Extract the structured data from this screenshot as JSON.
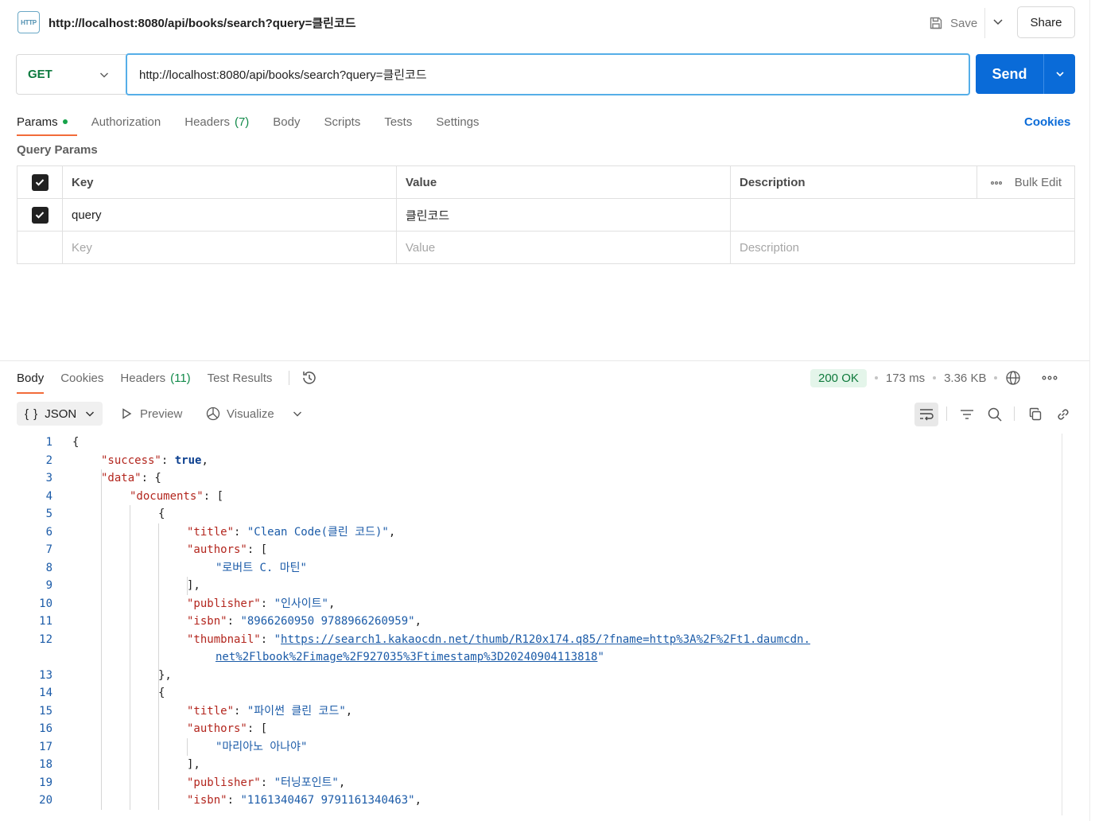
{
  "request": {
    "title": "http://localhost:8080/api/books/search?query=클린코드",
    "icon": "http-icon",
    "icon_text": "HTTP",
    "save_label": "Save",
    "share_label": "Share",
    "method": "GET",
    "url": "http://localhost:8080/api/books/search?query=클린코드",
    "send_label": "Send"
  },
  "request_tabs": [
    {
      "label": "Params"
    },
    {
      "label": "Authorization"
    },
    {
      "label": "Headers",
      "count": "(7)"
    },
    {
      "label": "Body"
    },
    {
      "label": "Scripts"
    },
    {
      "label": "Tests"
    },
    {
      "label": "Settings"
    }
  ],
  "cookies_label": "Cookies",
  "query_params": {
    "section_label": "Query Params",
    "headers": {
      "key": "Key",
      "value": "Value",
      "description": "Description",
      "bulk_edit": "Bulk Edit"
    },
    "rows": [
      {
        "checked": true,
        "key": "query",
        "value": "클린코드",
        "description": ""
      }
    ],
    "placeholders": {
      "key": "Key",
      "value": "Value",
      "description": "Description"
    }
  },
  "response_tabs": [
    {
      "label": "Body"
    },
    {
      "label": "Cookies"
    },
    {
      "label": "Headers",
      "count": "(11)"
    },
    {
      "label": "Test Results"
    }
  ],
  "response_status": {
    "status": "200 OK",
    "time": "173 ms",
    "size": "3.36 KB"
  },
  "response_toolbar": {
    "format": "JSON",
    "preview": "Preview",
    "visualize": "Visualize"
  },
  "colors": {
    "accent": "#0a6bd8",
    "tab_underline": "#f26b3a",
    "method_get": "#0c7a3e",
    "status_ok_bg": "#e4f5ea",
    "status_ok_text": "#0f7a3c",
    "json_key": "#b3261e",
    "json_string": "#1b5ba8"
  },
  "code_lines": [
    {
      "n": "1",
      "parts": [
        [
          "p",
          "{"
        ]
      ]
    },
    {
      "n": "2",
      "parts": [
        [
          "k",
          "\"success\""
        ],
        [
          "p",
          ": "
        ],
        [
          "b",
          "true"
        ],
        [
          "p",
          ","
        ]
      ]
    },
    {
      "n": "3",
      "parts": [
        [
          "k",
          "\"data\""
        ],
        [
          "p",
          ": {"
        ]
      ]
    },
    {
      "n": "4",
      "parts": [
        [
          "k",
          "\"documents\""
        ],
        [
          "p",
          ": ["
        ]
      ]
    },
    {
      "n": "5",
      "parts": [
        [
          "p",
          "{"
        ]
      ]
    },
    {
      "n": "6",
      "parts": [
        [
          "k",
          "\"title\""
        ],
        [
          "p",
          ": "
        ],
        [
          "s",
          "\"Clean Code(클린 코드)\""
        ],
        [
          "p",
          ","
        ]
      ]
    },
    {
      "n": "7",
      "parts": [
        [
          "k",
          "\"authors\""
        ],
        [
          "p",
          ": ["
        ]
      ]
    },
    {
      "n": "8",
      "parts": [
        [
          "s",
          "\"로버트 C. 마틴\""
        ]
      ]
    },
    {
      "n": "9",
      "parts": [
        [
          "p",
          "],"
        ]
      ]
    },
    {
      "n": "10",
      "parts": [
        [
          "k",
          "\"publisher\""
        ],
        [
          "p",
          ": "
        ],
        [
          "s",
          "\"인사이트\""
        ],
        [
          "p",
          ","
        ]
      ]
    },
    {
      "n": "11",
      "parts": [
        [
          "k",
          "\"isbn\""
        ],
        [
          "p",
          ": "
        ],
        [
          "s",
          "\"8966260950 9788966260959\""
        ],
        [
          "p",
          ","
        ]
      ]
    },
    {
      "n": "12",
      "parts": [
        [
          "k",
          "\"thumbnail\""
        ],
        [
          "p",
          ": "
        ],
        [
          "s",
          "\""
        ],
        [
          "u",
          "https://search1.kakaocdn.net/thumb/R120x174.q85/?fname=http%3A%2F%2Ft1.daumcdn."
        ]
      ]
    },
    {
      "n": "",
      "parts": [
        [
          "u",
          "net%2Flbook%2Fimage%2F927035%3Ftimestamp%3D20240904113818"
        ],
        [
          "s",
          "\""
        ]
      ]
    },
    {
      "n": "13",
      "parts": [
        [
          "p",
          "},"
        ]
      ]
    },
    {
      "n": "14",
      "parts": [
        [
          "p",
          "{"
        ]
      ]
    },
    {
      "n": "15",
      "parts": [
        [
          "k",
          "\"title\""
        ],
        [
          "p",
          ": "
        ],
        [
          "s",
          "\"파이썬 클린 코드\""
        ],
        [
          "p",
          ","
        ]
      ]
    },
    {
      "n": "16",
      "parts": [
        [
          "k",
          "\"authors\""
        ],
        [
          "p",
          ": ["
        ]
      ]
    },
    {
      "n": "17",
      "parts": [
        [
          "s",
          "\"마리아노 아나야\""
        ]
      ]
    },
    {
      "n": "18",
      "parts": [
        [
          "p",
          "],"
        ]
      ]
    },
    {
      "n": "19",
      "parts": [
        [
          "k",
          "\"publisher\""
        ],
        [
          "p",
          ": "
        ],
        [
          "s",
          "\"터닝포인트\""
        ],
        [
          "p",
          ","
        ]
      ]
    },
    {
      "n": "20",
      "parts": [
        [
          "k",
          "\"isbn\""
        ],
        [
          "p",
          ": "
        ],
        [
          "s",
          "\"1161340467 9791161340463\""
        ],
        [
          "p",
          ","
        ]
      ]
    }
  ]
}
